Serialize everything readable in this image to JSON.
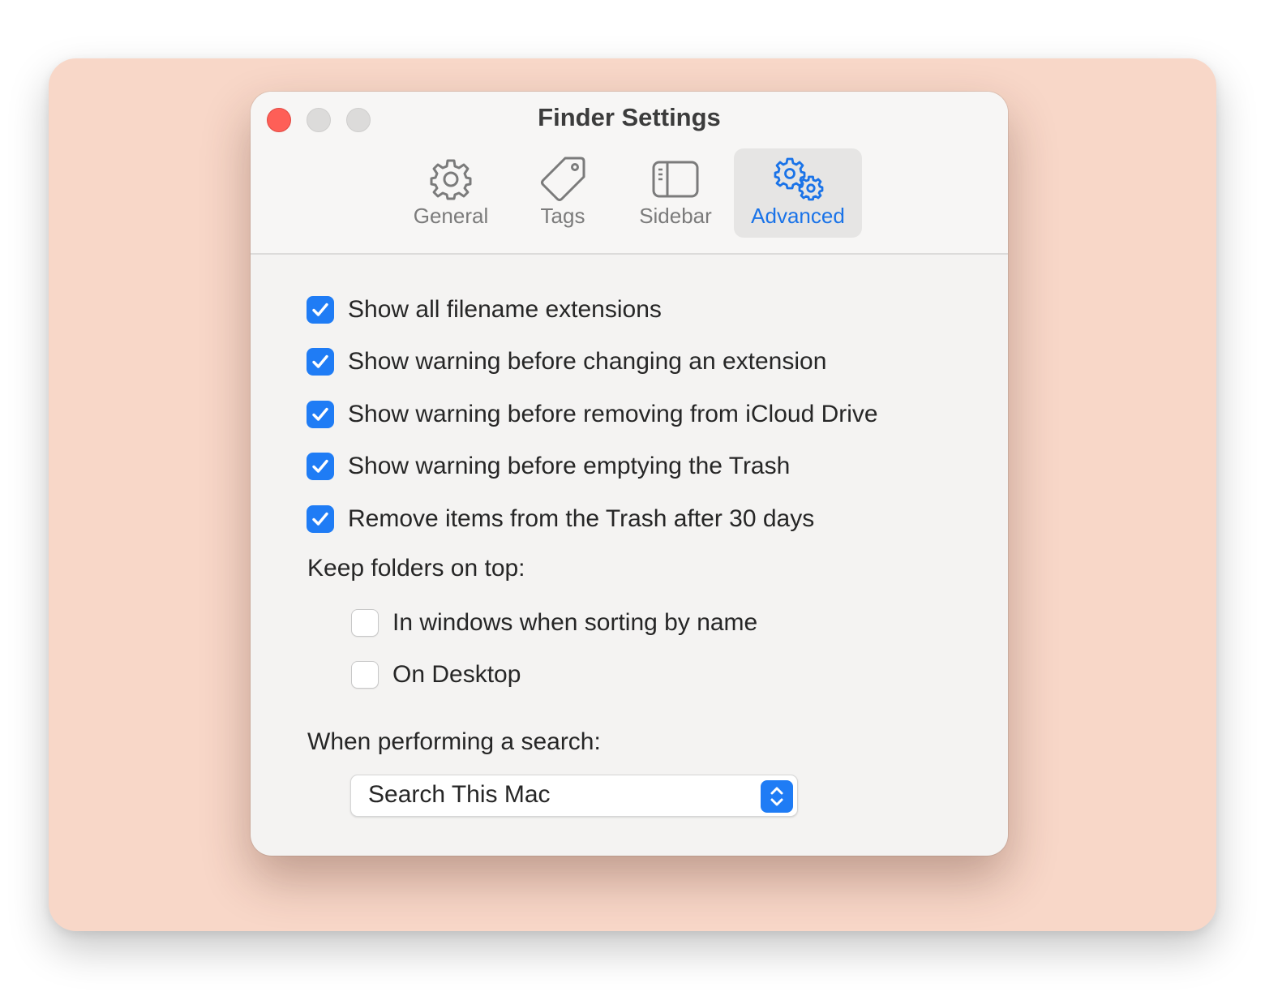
{
  "window": {
    "title": "Finder Settings"
  },
  "tabs": [
    {
      "label": "General",
      "icon": "gear-icon",
      "selected": false
    },
    {
      "label": "Tags",
      "icon": "tag-icon",
      "selected": false
    },
    {
      "label": "Sidebar",
      "icon": "sidebar-icon",
      "selected": false
    },
    {
      "label": "Advanced",
      "icon": "gears-icon",
      "selected": true
    }
  ],
  "options": [
    {
      "label": "Show all filename extensions",
      "checked": true
    },
    {
      "label": "Show warning before changing an extension",
      "checked": true
    },
    {
      "label": "Show warning before removing from iCloud Drive",
      "checked": true
    },
    {
      "label": "Show warning before emptying the Trash",
      "checked": true
    },
    {
      "label": "Remove items from the Trash after 30 days",
      "checked": true
    }
  ],
  "keep_folders": {
    "label": "Keep folders on top:",
    "options": [
      {
        "label": "In windows when sorting by name",
        "checked": false
      },
      {
        "label": "On Desktop",
        "checked": false
      }
    ]
  },
  "search": {
    "label": "When performing a search:",
    "selected": "Search This Mac"
  },
  "colors": {
    "accent": "#1f7cf5",
    "close_button": "#fe5f57",
    "backdrop": "#f8d7c8"
  }
}
